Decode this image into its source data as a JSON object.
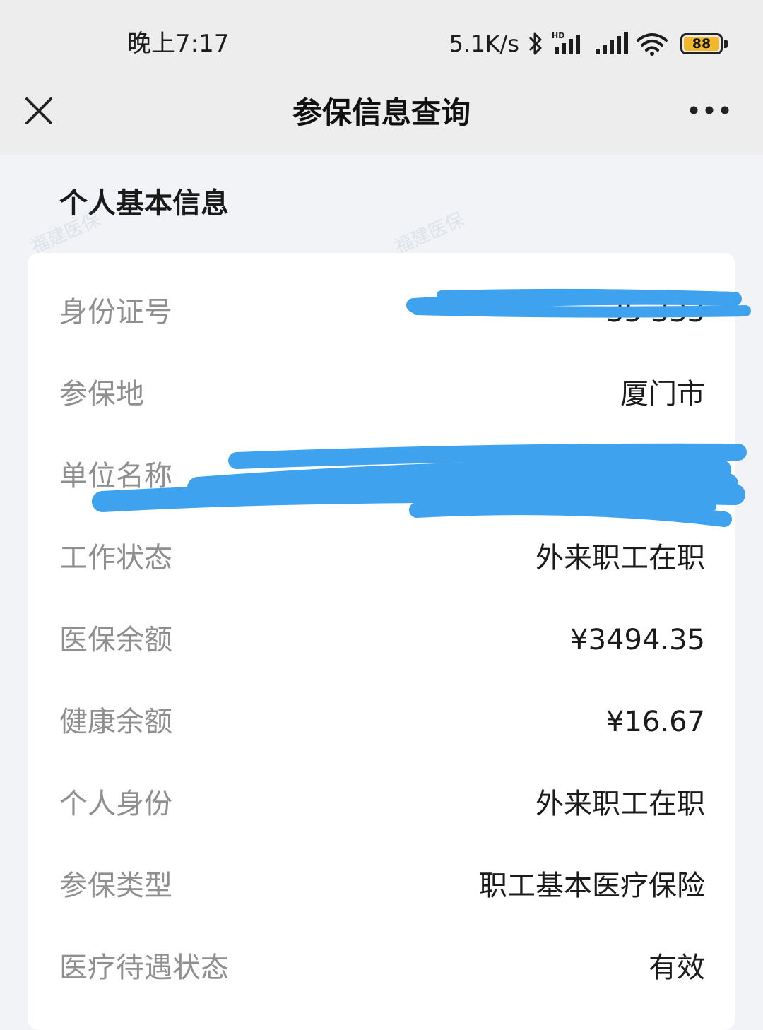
{
  "status_bar": {
    "time": "晚上7:17",
    "network_speed": "5.1K/s",
    "battery_level": "88",
    "icons": [
      "bluetooth-icon",
      "hd-signal-icon",
      "signal-icon",
      "wifi-icon",
      "battery-icon"
    ]
  },
  "header": {
    "title": "参保信息查询",
    "close_icon": "close-icon",
    "more_icon": "more-icon"
  },
  "section": {
    "title": "个人基本信息"
  },
  "watermark": "福建医保",
  "rows": [
    {
      "label": "身份证号",
      "value": "35                    333"
    },
    {
      "label": "参保地",
      "value": "厦门市"
    },
    {
      "label": "单位名称",
      "value": ""
    },
    {
      "label": "工作状态",
      "value": "外来职工在职"
    },
    {
      "label": "医保余额",
      "value": "¥3494.35"
    },
    {
      "label": "健康余额",
      "value": "¥16.67"
    },
    {
      "label": "个人身份",
      "value": "外来职工在职"
    },
    {
      "label": "参保类型",
      "value": "职工基本医疗保险"
    },
    {
      "label": "医疗待遇状态",
      "value": "有效"
    }
  ],
  "colors": {
    "background": "#f1f3f6",
    "header": "#ededed",
    "card": "#ffffff",
    "label": "#8f8f8f",
    "value": "#1b1b1b",
    "redaction": "#3fa2ee",
    "battery": "#f2b72a"
  }
}
